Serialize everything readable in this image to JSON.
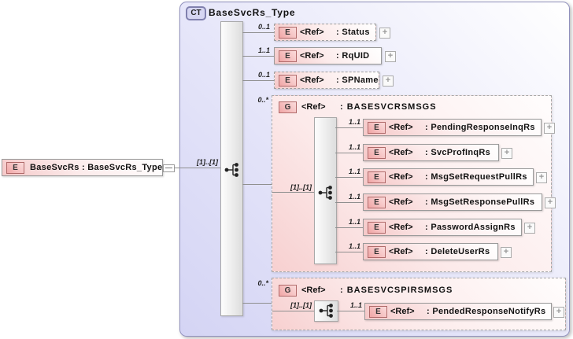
{
  "container": {
    "badge": "CT",
    "title": "BaseSvcRs_Type"
  },
  "root": {
    "badge": "E",
    "label": "BaseSvcRs : BaseSvcRs_Type",
    "cardinality": "[1]..[1]"
  },
  "icons": {
    "plus": "+"
  },
  "colors": {
    "panel_lavender": "#d4d4f4",
    "element_pink": "#f5c8c8",
    "badge_border": "#b06a6a",
    "group_pink": "#f7d0d0"
  },
  "top_children": [
    {
      "badge": "E",
      "ref": "<Ref>",
      "name": ": Status",
      "cardinality": "0..1"
    },
    {
      "badge": "E",
      "ref": "<Ref>",
      "name": ": RqUID",
      "cardinality": "1..1"
    },
    {
      "badge": "E",
      "ref": "<Ref>",
      "name": ": SPName",
      "cardinality": "0..1"
    }
  ],
  "groups": [
    {
      "badge": "G",
      "ref": "<Ref>",
      "name": ": BASESVCRSMSGS",
      "cardinality": "0..*",
      "sequence_cardinality": "[1]..[1]",
      "children": [
        {
          "badge": "E",
          "ref": "<Ref>",
          "name": ": PendingResponseInqRs",
          "cardinality": "1..1"
        },
        {
          "badge": "E",
          "ref": "<Ref>",
          "name": ": SvcProfInqRs",
          "cardinality": "1..1"
        },
        {
          "badge": "E",
          "ref": "<Ref>",
          "name": ": MsgSetRequestPullRs",
          "cardinality": "1..1"
        },
        {
          "badge": "E",
          "ref": "<Ref>",
          "name": ": MsgSetResponsePullRs",
          "cardinality": "1..1"
        },
        {
          "badge": "E",
          "ref": "<Ref>",
          "name": ": PasswordAssignRs",
          "cardinality": "1..1"
        },
        {
          "badge": "E",
          "ref": "<Ref>",
          "name": ": DeleteUserRs",
          "cardinality": "1..1"
        }
      ]
    },
    {
      "badge": "G",
      "ref": "<Ref>",
      "name": ": BASESVCSPIRSMSGS",
      "cardinality": "0..*",
      "sequence_cardinality": "[1]..[1]",
      "children": [
        {
          "badge": "E",
          "ref": "<Ref>",
          "name": ": PendedResponseNotifyRs",
          "cardinality": "1..1"
        }
      ]
    }
  ]
}
